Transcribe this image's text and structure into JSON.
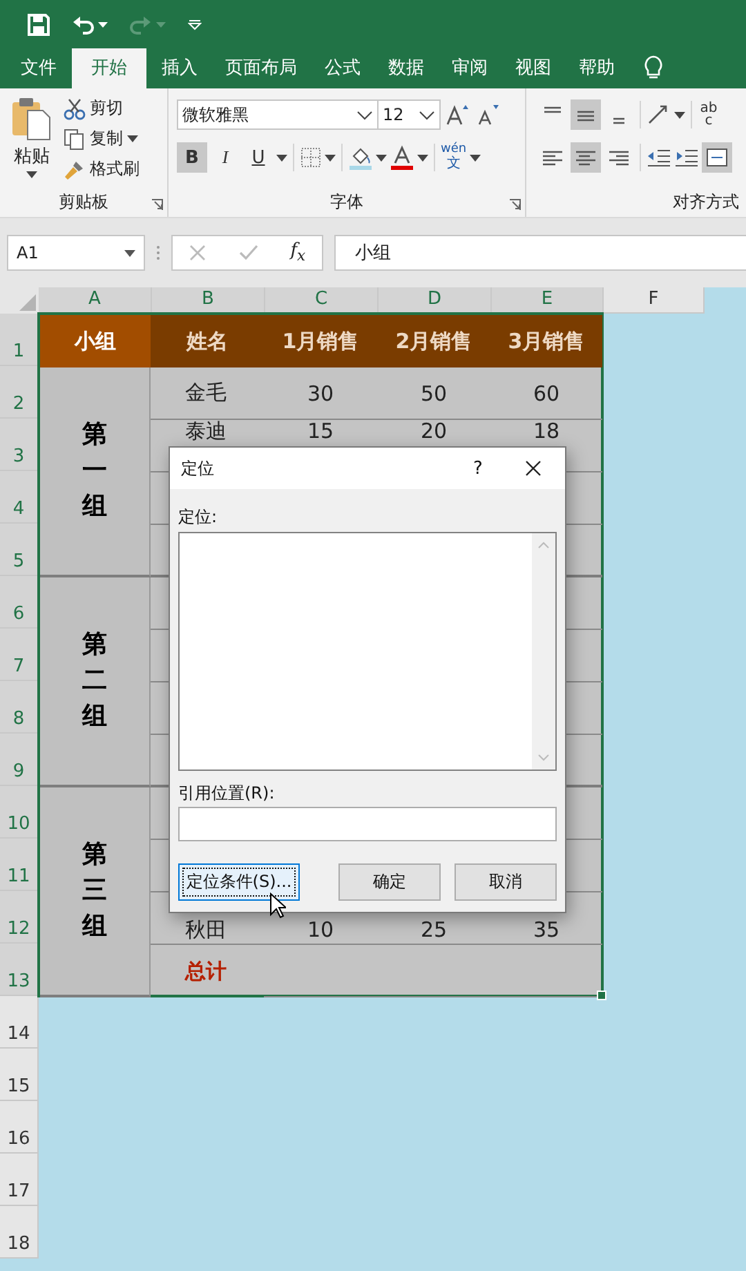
{
  "quick_access": [
    {
      "kind": "save",
      "disabled": false
    },
    {
      "kind": "undo",
      "disabled": false
    },
    {
      "kind": "redo",
      "disabled": true
    },
    {
      "kind": "customize",
      "disabled": false
    }
  ],
  "tabs": [
    {
      "label": "文件",
      "selected": false
    },
    {
      "label": "开始",
      "selected": true
    },
    {
      "label": "插入",
      "selected": false
    },
    {
      "label": "页面布局",
      "selected": false
    },
    {
      "label": "公式",
      "selected": false
    },
    {
      "label": "数据",
      "selected": false
    },
    {
      "label": "审阅",
      "selected": false
    },
    {
      "label": "视图",
      "selected": false
    },
    {
      "label": "帮助",
      "selected": false
    }
  ],
  "ribbon": {
    "clipboard": {
      "paste": "粘贴",
      "cut": "剪切",
      "copy": "复制",
      "format_painter": "格式刷",
      "label": "剪贴板"
    },
    "font": {
      "name": "微软雅黑",
      "size": "12",
      "styles": [
        {
          "kind": "bold",
          "label": "B",
          "on": true
        },
        {
          "kind": "italic",
          "label": "I",
          "on": false
        },
        {
          "kind": "underline",
          "label": "U",
          "on": false
        }
      ],
      "pinyin": "wén",
      "pinyin_char": "文",
      "label": "字体"
    },
    "alignment": {
      "label": "对齐方式",
      "wrap_text": "ab c",
      "buttons": [
        {
          "kind": "top",
          "on": false
        },
        {
          "kind": "middle",
          "on": true
        },
        {
          "kind": "bottom",
          "on": false
        },
        {
          "kind": "left",
          "on": false
        },
        {
          "kind": "center",
          "on": true
        },
        {
          "kind": "right",
          "on": false
        }
      ]
    }
  },
  "formula_bar": {
    "name_box": "A1",
    "function_symbol": "f$_{x}$",
    "formula": "小组"
  },
  "sheet": {
    "columns": [
      "A",
      "B",
      "C",
      "D",
      "E",
      "F"
    ],
    "row_numbers": [
      "1",
      "2",
      "3",
      "4",
      "5",
      "6",
      "7",
      "8",
      "9",
      "10",
      "11",
      "12",
      "13",
      "14",
      "15",
      "16",
      "17",
      "18"
    ],
    "header": [
      "小组",
      "姓名",
      "1月销售",
      "2月销售",
      "3月销售"
    ],
    "groups": [
      "第一组",
      "第二组",
      "第三组"
    ],
    "data_rows": [
      {
        "cells": [
          "金毛",
          "30",
          "50",
          "60"
        ]
      },
      {
        "cells": [
          "泰迪",
          "15",
          "20",
          "18"
        ]
      },
      {
        "cells": [
          "秋田",
          "10",
          "25",
          "35"
        ]
      }
    ],
    "total_label": "总计"
  },
  "dialog": {
    "title": "定位",
    "help": "?",
    "list_label": "定位:",
    "reference_label": "引用位置(R):",
    "buttons": [
      {
        "label": "定位条件(S)...",
        "selected": true
      },
      {
        "label": "确定",
        "selected": false
      },
      {
        "label": "取消",
        "selected": false
      }
    ]
  }
}
